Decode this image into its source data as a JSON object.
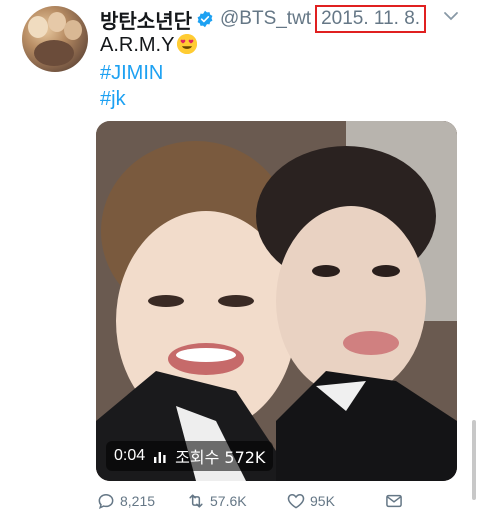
{
  "author": {
    "display_name": "방탄소년단",
    "handle": "@BTS_twt",
    "date": "2015. 11. 8.",
    "verified_icon": "verified-badge-icon"
  },
  "tweet": {
    "text_line": "A.R.M.Y",
    "emoji": "heart-eyes-emoji",
    "hashtags": [
      "#JIMIN",
      "#jk"
    ]
  },
  "video": {
    "duration": "0:04",
    "views_label": "조회수 572K"
  },
  "actions": {
    "replies": "8,215",
    "retweets": "57.6K",
    "likes": "95K"
  },
  "colors": {
    "link": "#1da1f2",
    "muted": "#657786",
    "highlight": "#e02020"
  }
}
